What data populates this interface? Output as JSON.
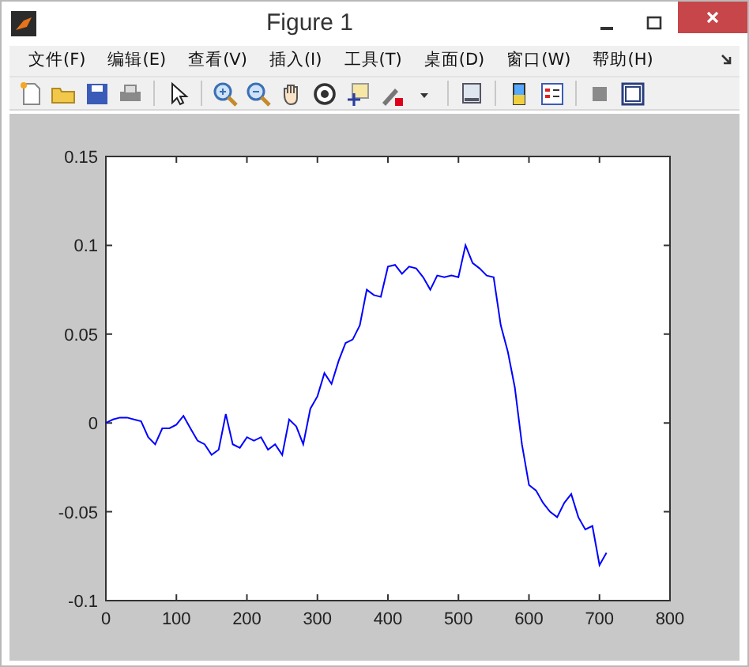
{
  "window": {
    "title": "Figure 1"
  },
  "menu": [
    "文件(F)",
    "编辑(E)",
    "查看(V)",
    "插入(I)",
    "工具(T)",
    "桌面(D)",
    "窗口(W)",
    "帮助(H)"
  ],
  "figure": {
    "chart_data": {
      "type": "line",
      "xlim": [
        0,
        800
      ],
      "ylim": [
        -0.1,
        0.15
      ],
      "xticks": [
        0,
        100,
        200,
        300,
        400,
        500,
        600,
        700,
        800
      ],
      "yticks": [
        {
          "value": -0.1,
          "label": "-0.1"
        },
        {
          "value": -0.05,
          "label": "-0.05"
        },
        {
          "value": 0,
          "label": "0"
        },
        {
          "value": 0.05,
          "label": "0.05"
        },
        {
          "value": 0.1,
          "label": "0.1"
        },
        {
          "value": 0.15,
          "label": "0.15"
        }
      ],
      "x": [
        0,
        10,
        20,
        30,
        40,
        50,
        60,
        70,
        80,
        90,
        100,
        110,
        120,
        130,
        140,
        150,
        160,
        170,
        180,
        190,
        200,
        210,
        220,
        230,
        240,
        250,
        260,
        270,
        280,
        290,
        300,
        310,
        320,
        330,
        340,
        350,
        360,
        370,
        380,
        390,
        400,
        410,
        420,
        430,
        440,
        450,
        460,
        470,
        480,
        490,
        500,
        510,
        520,
        530,
        540,
        550,
        560,
        570,
        580,
        590,
        600,
        610,
        620,
        630,
        640,
        650,
        660,
        670,
        680,
        690,
        700,
        710
      ],
      "series": [
        {
          "color": "#0000ff",
          "values": [
            0,
            0.002,
            0.003,
            0.003,
            0.002,
            0.001,
            -0.008,
            -0.012,
            -0.003,
            -0.003,
            -0.001,
            0.004,
            -0.003,
            -0.01,
            -0.012,
            -0.018,
            -0.015,
            0.005,
            -0.012,
            -0.014,
            -0.008,
            -0.01,
            -0.008,
            -0.015,
            -0.012,
            -0.018,
            0.002,
            -0.002,
            -0.012,
            0.008,
            0.015,
            0.028,
            0.022,
            0.035,
            0.045,
            0.047,
            0.055,
            0.075,
            0.072,
            0.071,
            0.088,
            0.089,
            0.084,
            0.088,
            0.087,
            0.082,
            0.075,
            0.083,
            0.082,
            0.083,
            0.082,
            0.1,
            0.09,
            0.087,
            0.083,
            0.082,
            0.055,
            0.04,
            0.02,
            -0.012,
            -0.035,
            -0.038,
            -0.045,
            -0.05,
            -0.053,
            -0.045,
            -0.04,
            -0.053,
            -0.06,
            -0.058,
            -0.08,
            -0.073
          ]
        }
      ]
    }
  }
}
